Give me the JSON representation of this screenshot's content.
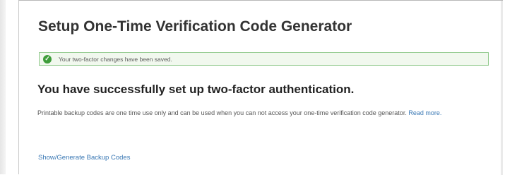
{
  "page": {
    "title": "Setup One-Time Verification Code Generator"
  },
  "alert": {
    "icon": "check-circle-icon",
    "message": "Your two-factor changes have been saved.",
    "color": "#3f9d3b"
  },
  "main": {
    "heading": "You have successfully set up two-factor authentication.",
    "description": "Printable backup codes are one time use only and can be used when you can not access your one-time verification code generator.",
    "read_more_label": "Read more.",
    "backup_codes_link": "Show/Generate Backup Codes",
    "link_color": "#3a78b4"
  }
}
